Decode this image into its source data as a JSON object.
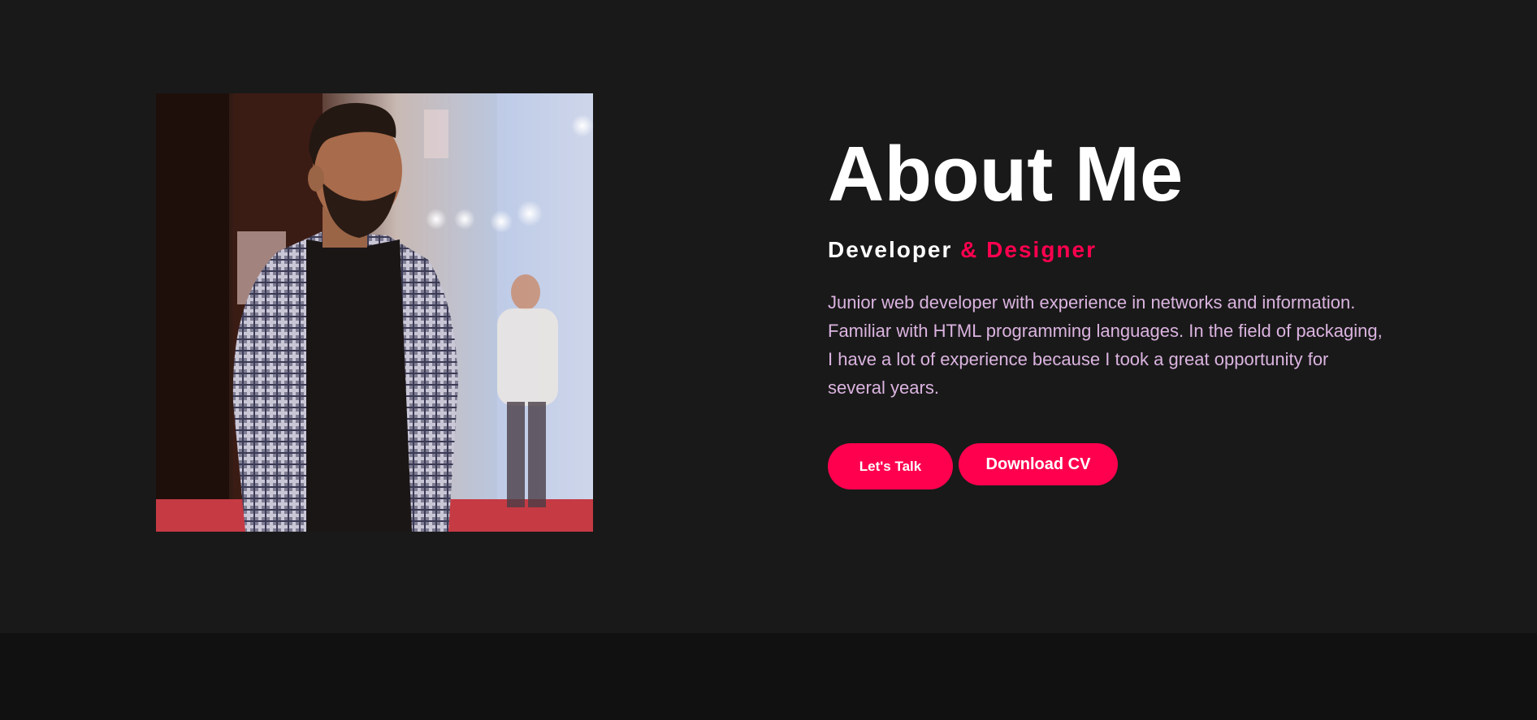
{
  "about": {
    "title": "About Me",
    "subtitle_primary": "Developer ",
    "subtitle_accent": "& Designer",
    "bio": "Junior web developer with experience in networks and information. Familiar with HTML programming languages. In the field of packaging, I have a lot of experience because I took a great opportunity for several years."
  },
  "buttons": {
    "talk_label": "Let's Talk",
    "cv_label": "Download CV"
  },
  "colors": {
    "background": "#191919",
    "footer": "#111111",
    "accent": "#ff004f",
    "text": "#ffffff",
    "bio_text": "#dbb4e0"
  },
  "images": {
    "profile": "profile-photo"
  }
}
